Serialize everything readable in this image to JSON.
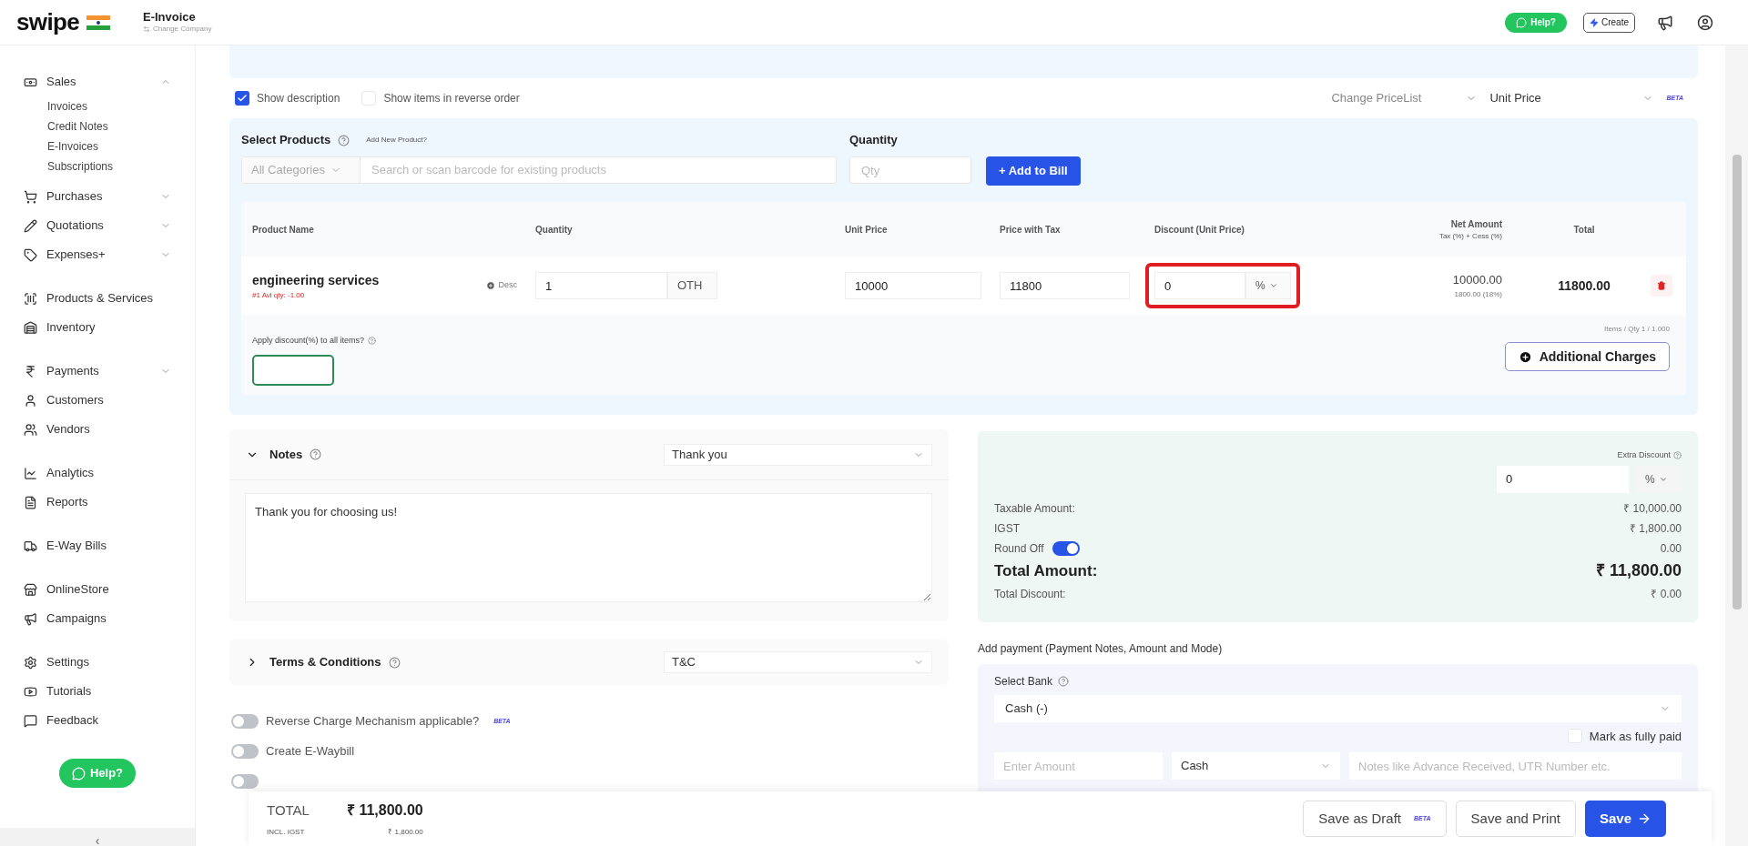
{
  "topbar": {
    "logo": "swipe",
    "company": "E-Invoice",
    "change_company": "Change Company",
    "help": "Help?",
    "create": "Create"
  },
  "sidebar": {
    "groups": [
      [
        {
          "label": "Sales",
          "expanded": true,
          "children": [
            "Invoices",
            "Credit Notes",
            "E-Invoices",
            "Subscriptions"
          ]
        },
        {
          "label": "Purchases",
          "expanded": false
        },
        {
          "label": "Quotations",
          "expanded": false
        },
        {
          "label": "Expenses+",
          "expanded": false
        }
      ],
      [
        {
          "label": "Products & Services"
        },
        {
          "label": "Inventory"
        }
      ],
      [
        {
          "label": "Payments",
          "expanded": false
        },
        {
          "label": "Customers"
        },
        {
          "label": "Vendors"
        }
      ],
      [
        {
          "label": "Analytics"
        },
        {
          "label": "Reports"
        }
      ],
      [
        {
          "label": "E-Way Bills"
        }
      ],
      [
        {
          "label": "OnlineStore"
        },
        {
          "label": "Campaigns"
        }
      ],
      [
        {
          "label": "Settings"
        },
        {
          "label": "Tutorials"
        },
        {
          "label": "Feedback"
        }
      ]
    ],
    "help": "Help?",
    "collapse": "‹"
  },
  "options": [
    {
      "label": "Show description",
      "checked": true
    },
    {
      "label": "Show items in reverse order",
      "checked": false
    }
  ],
  "pricelist": {
    "label": "Change PriceList",
    "value": "Unit Price",
    "badge": "BETA"
  },
  "products": {
    "title": "Select Products",
    "add_new": "Add New Product?",
    "category": "All Categories",
    "search_placeholder": "Search or scan barcode for existing products",
    "quantity_label": "Quantity",
    "quantity_placeholder": "Qty",
    "add_button": "+ Add to Bill"
  },
  "table": {
    "columns": [
      "Product Name",
      "Quantity",
      "Unit Price",
      "Price with Tax",
      "Discount (Unit Price)",
      "Net Amount",
      "Total"
    ],
    "net_sub": "Tax (%) + Cess (%)",
    "rows": [
      {
        "name": "engineering services",
        "stock": "#1 Avl qty: -1.00",
        "desc": "Desc",
        "quantity": "1",
        "unit": "OTH",
        "unit_price": "10000",
        "price_with_tax": "11800",
        "discount": "0",
        "discount_type": "%",
        "highlighted": true,
        "net": "10000.00",
        "tax": "1800.00 (18%)",
        "total": "11800.00"
      }
    ],
    "apply_discount": "Apply discount(%) to all items?",
    "items_qty": "Items / Qty 1 / 1.000",
    "additional_charges": "Additional Charges"
  },
  "notes": {
    "title": "Notes",
    "expanded": true,
    "template": "Thank you",
    "text": "Thank you for choosing us!"
  },
  "terms": {
    "title": "Terms & Conditions",
    "expanded": false,
    "template": "T&C"
  },
  "toggles": [
    {
      "label": "Reverse Charge Mechanism applicable?",
      "badge": "BETA",
      "on": false
    },
    {
      "label": "Create E-Waybill",
      "on": false
    },
    {
      "on": false
    }
  ],
  "summary": {
    "extra_discount_label": "Extra Discount",
    "extra_discount": "0",
    "extra_discount_type": "%",
    "rows": [
      {
        "label": "Taxable Amount:",
        "value": "₹ 10,000.00",
        "kind": "plain"
      },
      {
        "label": "IGST",
        "value": "₹ 1,800.00",
        "kind": "plain"
      },
      {
        "label": "Round Off",
        "value": "0.00",
        "kind": "toggle",
        "on": true
      },
      {
        "label": "Total Amount:",
        "value": "₹ 11,800.00",
        "kind": "total"
      },
      {
        "label": "Total Discount:",
        "value": "₹ 0.00",
        "kind": "plain"
      }
    ]
  },
  "payment": {
    "title": "Add payment (Payment Notes, Amount and Mode)",
    "bank_label": "Select Bank",
    "bank": "Cash (-)",
    "fully_paid": "Mark as fully paid",
    "fully_paid_checked": false,
    "amount_placeholder": "Enter Amount",
    "mode": "Cash",
    "notes_placeholder": "Notes like Advance Received, UTR Number etc."
  },
  "footer": {
    "total_label": "TOTAL",
    "total": "₹ 11,800.00",
    "tax_label": "INCL. IGST",
    "tax": "₹ 1,800.00",
    "draft": "Save as Draft",
    "draft_badge": "BETA",
    "print": "Save and Print",
    "save": "Save"
  }
}
